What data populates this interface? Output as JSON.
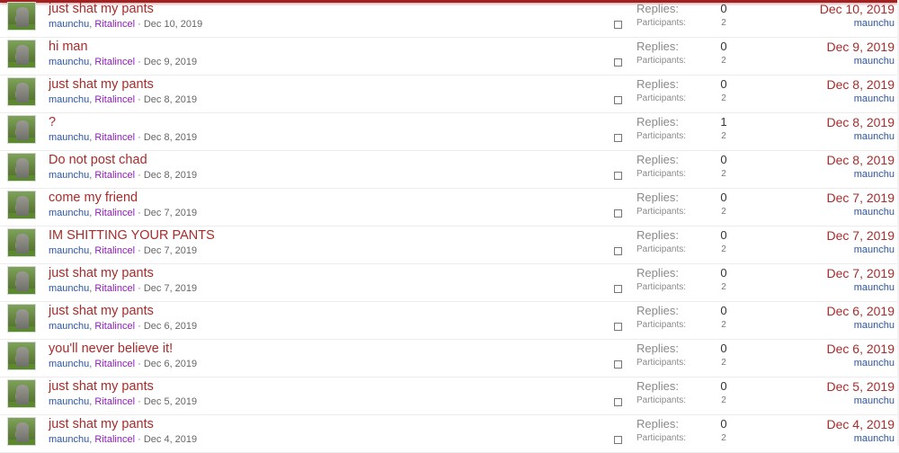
{
  "labels": {
    "replies": "Replies:",
    "participants": "Participants:"
  },
  "conversations": [
    {
      "title": "just shat my pants",
      "user1": "maunchu",
      "user2": "Ritalincel",
      "sep": ",",
      "date": "Dec 10, 2019",
      "replies": "0",
      "participants": "2",
      "last_date": "Dec 10, 2019",
      "last_user": "maunchu"
    },
    {
      "title": "hi man",
      "user1": "maunchu",
      "user2": "Ritalincel",
      "sep": ",",
      "date": "Dec 9, 2019",
      "replies": "0",
      "participants": "2",
      "last_date": "Dec 9, 2019",
      "last_user": "maunchu"
    },
    {
      "title": "just shat my pants",
      "user1": "maunchu",
      "user2": "Ritalincel",
      "sep": ",",
      "date": "Dec 8, 2019",
      "replies": "0",
      "participants": "2",
      "last_date": "Dec 8, 2019",
      "last_user": "maunchu"
    },
    {
      "title": "?",
      "user1": "maunchu",
      "user2": "Ritalincel",
      "sep": ",",
      "date": "Dec 8, 2019",
      "replies": "1",
      "participants": "2",
      "last_date": "Dec 8, 2019",
      "last_user": "maunchu"
    },
    {
      "title": "Do not post chad",
      "user1": "maunchu",
      "user2": "Ritalincel",
      "sep": ",",
      "date": "Dec 8, 2019",
      "replies": "0",
      "participants": "2",
      "last_date": "Dec 8, 2019",
      "last_user": "maunchu"
    },
    {
      "title": "come my friend",
      "user1": "maunchu",
      "user2": "Ritalincel",
      "sep": ",",
      "date": "Dec 7, 2019",
      "replies": "0",
      "participants": "2",
      "last_date": "Dec 7, 2019",
      "last_user": "maunchu"
    },
    {
      "title": "IM SHITTING YOUR PANTS",
      "user1": "maunchu",
      "user2": "Ritalincel",
      "sep": ",",
      "date": "Dec 7, 2019",
      "replies": "0",
      "participants": "2",
      "last_date": "Dec 7, 2019",
      "last_user": "maunchu"
    },
    {
      "title": "just shat my pants",
      "user1": "maunchu",
      "user2": "Ritalincel",
      "sep": ",",
      "date": "Dec 7, 2019",
      "replies": "0",
      "participants": "2",
      "last_date": "Dec 7, 2019",
      "last_user": "maunchu"
    },
    {
      "title": "just shat my pants",
      "user1": "maunchu",
      "user2": "Ritalincel",
      "sep": ",",
      "date": "Dec 6, 2019",
      "replies": "0",
      "participants": "2",
      "last_date": "Dec 6, 2019",
      "last_user": "maunchu"
    },
    {
      "title": "you'll never believe it!",
      "user1": "maunchu",
      "user2": "Ritalincel",
      "sep": ",",
      "date": "Dec 6, 2019",
      "replies": "0",
      "participants": "2",
      "last_date": "Dec 6, 2019",
      "last_user": "maunchu"
    },
    {
      "title": "just shat my pants",
      "user1": "maunchu",
      "user2": "Ritalincel",
      "sep": ",",
      "date": "Dec 5, 2019",
      "replies": "0",
      "participants": "2",
      "last_date": "Dec 5, 2019",
      "last_user": "maunchu"
    },
    {
      "title": "just shat my pants",
      "user1": "maunchu",
      "user2": "Ritalincel",
      "sep": ",",
      "date": "Dec 4, 2019",
      "replies": "0",
      "participants": "2",
      "last_date": "Dec 4, 2019",
      "last_user": "maunchu"
    }
  ]
}
